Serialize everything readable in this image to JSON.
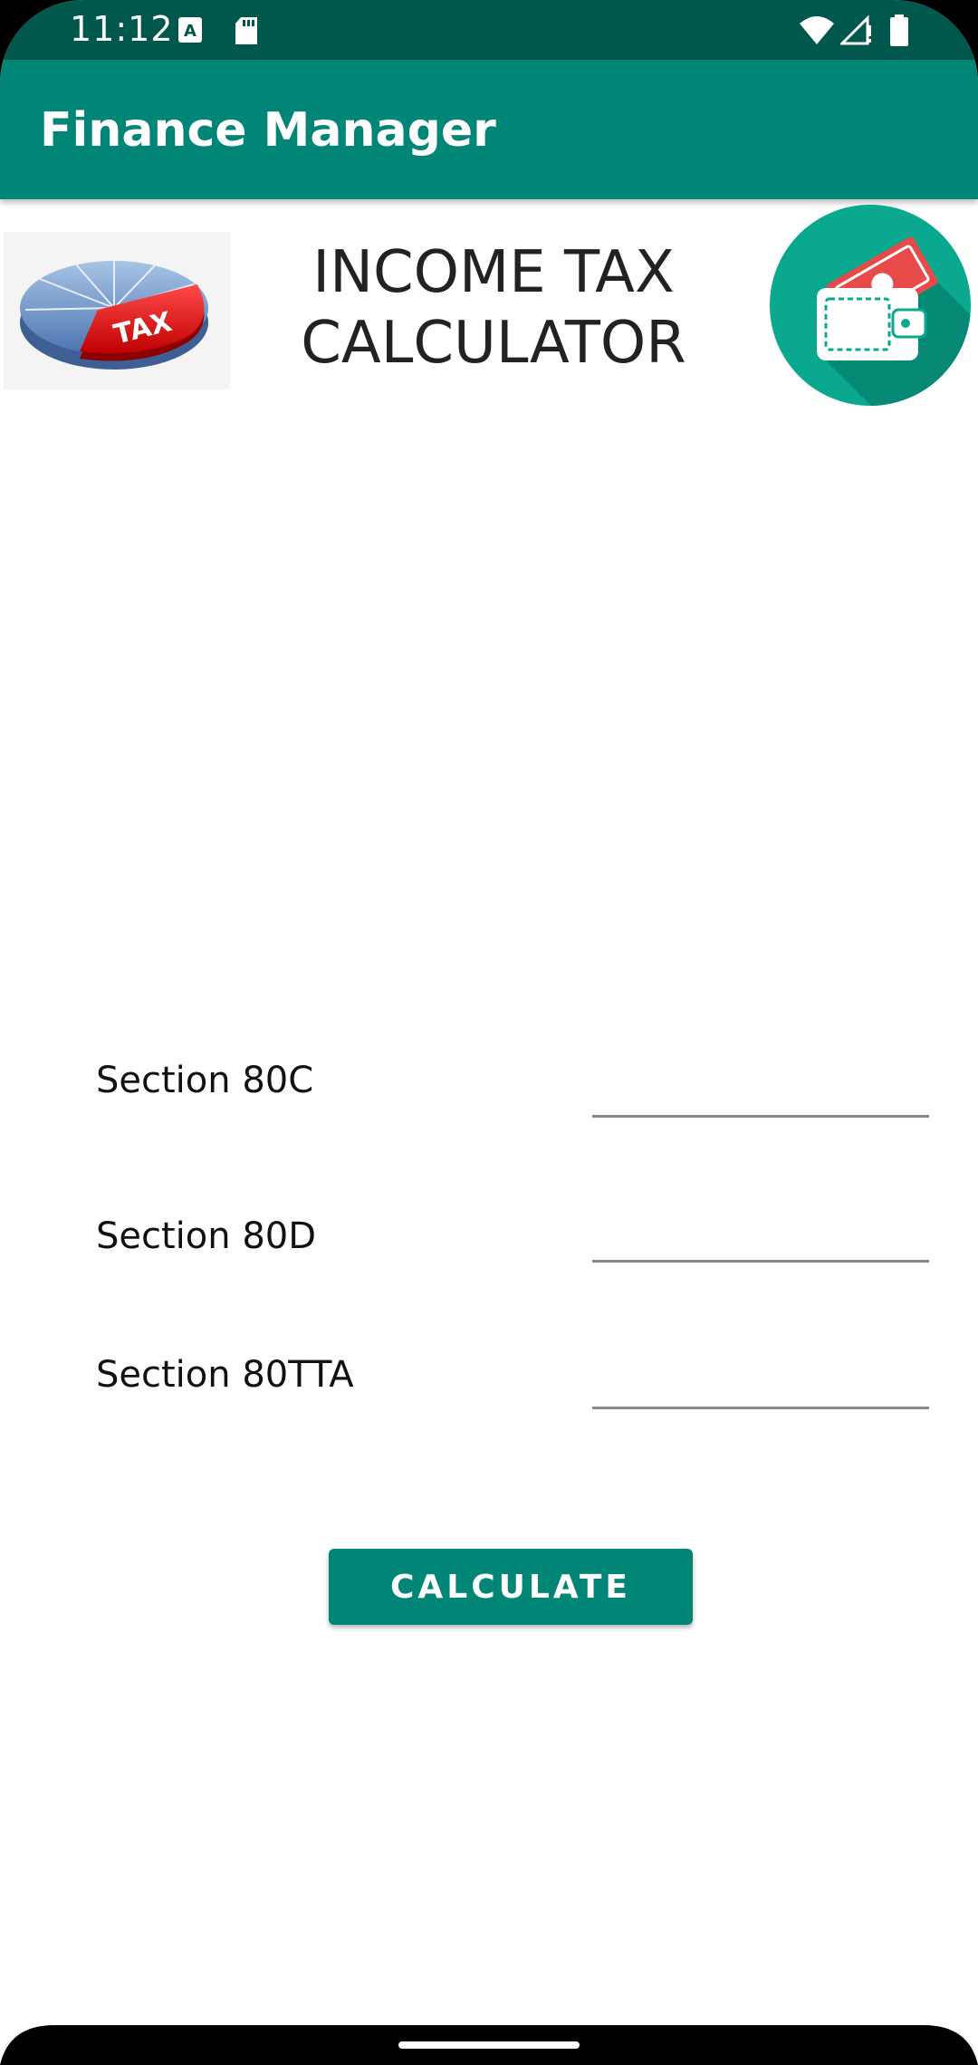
{
  "status_bar": {
    "time": "11:12",
    "icons": [
      "a-notification-icon",
      "sd-card-icon",
      "wifi-icon",
      "signal-icon",
      "battery-icon"
    ]
  },
  "app_bar": {
    "title": "Finance Manager",
    "color": "#008577"
  },
  "header": {
    "title_line1": "INCOME TAX",
    "title_line2": "CALCULATOR",
    "tax_image_text": "TAX",
    "left_image": "tax-pie-chart-image",
    "right_logo": "wallet-logo"
  },
  "form": {
    "fields": [
      {
        "label": "Section 80C",
        "value": ""
      },
      {
        "label": "Section 80D",
        "value": ""
      },
      {
        "label": "Section 80TTA",
        "value": ""
      }
    ]
  },
  "button": {
    "calculate_label": "CALCULATE"
  },
  "colors": {
    "primary": "#008577",
    "primary_dark": "#00574b",
    "logo_bg": "#0aa88f"
  }
}
